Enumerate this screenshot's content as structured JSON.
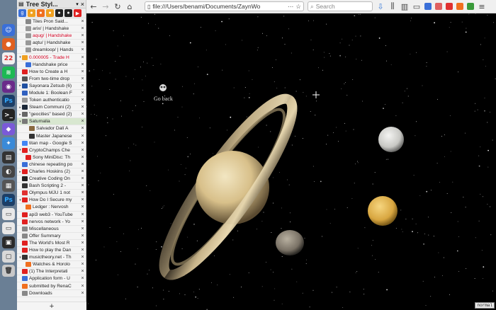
{
  "sidebar": {
    "title": "Tree Styl...",
    "new_tab": "+",
    "tabs": [
      {
        "title": "Tiles Pron Said...",
        "indent": 1,
        "fav": "#888",
        "red": false
      },
      {
        "title": "arix/ | Handshake",
        "indent": 1,
        "fav": "#999",
        "red": false
      },
      {
        "title": "aqug/ | Handshake",
        "indent": 1,
        "fav": "#999",
        "red": true
      },
      {
        "title": "aqtu/ | Handshake",
        "indent": 1,
        "fav": "#999",
        "red": false
      },
      {
        "title": "dreamloop/ | Hands",
        "indent": 1,
        "fav": "#999",
        "red": false
      },
      {
        "title": "0.000005 - Trade H",
        "indent": 0,
        "fav": "#f0a020",
        "red": true,
        "tw": "v"
      },
      {
        "title": "Handshake price",
        "indent": 1,
        "fav": "#3a6fd8",
        "red": false
      },
      {
        "title": "How to Create a H",
        "indent": 0,
        "fav": "#e02020",
        "red": false
      },
      {
        "title": "From two-time drop",
        "indent": 0,
        "fav": "#555",
        "red": false
      },
      {
        "title": "Sayonara Zetsub (6)",
        "indent": 0,
        "fav": "#2050a0",
        "red": false,
        "tw": ">"
      },
      {
        "title": "Module 1: Boolean F",
        "indent": 0,
        "fav": "#3060c0",
        "red": false
      },
      {
        "title": "Token authenticatio",
        "indent": 0,
        "fav": "#999",
        "red": false
      },
      {
        "title": "Steam Communi (2)",
        "indent": 0,
        "fav": "#1b2838",
        "red": false,
        "tw": ">"
      },
      {
        "title": "\"geocities\" based (2)",
        "indent": 0,
        "fav": "#666",
        "red": false,
        "tw": ">"
      },
      {
        "title": "Saturnalia",
        "indent": 0,
        "fav": "#777",
        "red": false,
        "tw": "v",
        "active": true
      },
      {
        "title": "Salvador Dalí A",
        "indent": 2,
        "fav": "#8a6a40",
        "red": false
      },
      {
        "title": "Master Japanese",
        "indent": 2,
        "fav": "#333",
        "red": false
      },
      {
        "title": "titan map - Google S",
        "indent": 0,
        "fav": "#4285f4",
        "red": false
      },
      {
        "title": "CryptoChamps Che",
        "indent": 0,
        "fav": "#e02020",
        "red": false,
        "tw": "v"
      },
      {
        "title": "Sony MiniDisc: Th",
        "indent": 1,
        "fav": "#e02020",
        "red": false
      },
      {
        "title": "chinese repeating po",
        "indent": 0,
        "fav": "#3a6fd8",
        "red": false
      },
      {
        "title": "Charles Hoskins (2)",
        "indent": 0,
        "fav": "#e02020",
        "red": false,
        "tw": ">"
      },
      {
        "title": "Creative Coding On",
        "indent": 0,
        "fav": "#222",
        "red": false
      },
      {
        "title": "Bash Scripting 2 -",
        "indent": 0,
        "fav": "#333",
        "red": false
      },
      {
        "title": "Olympus MJU 1 not",
        "indent": 0,
        "fav": "#e03030",
        "red": false
      },
      {
        "title": "How Do I Secure my",
        "indent": 0,
        "fav": "#e02020",
        "red": false,
        "tw": "v"
      },
      {
        "title": "Ledger : Nervosh",
        "indent": 1,
        "fav": "#f07020",
        "red": false
      },
      {
        "title": "api3 web3 - YouTube",
        "indent": 0,
        "fav": "#e02020",
        "red": false
      },
      {
        "title": "nervos network - Yo",
        "indent": 0,
        "fav": "#e02020",
        "red": false
      },
      {
        "title": "Miscellaneous",
        "indent": 0,
        "fav": "#888",
        "red": false
      },
      {
        "title": "Offer Summary",
        "indent": 0,
        "fav": "#888",
        "red": false
      },
      {
        "title": "The World's Most R",
        "indent": 0,
        "fav": "#e02020",
        "red": false
      },
      {
        "title": "How to play the Dan",
        "indent": 0,
        "fav": "#e02020",
        "red": false
      },
      {
        "title": "musictheory.net - Th",
        "indent": 0,
        "fav": "#333",
        "red": false,
        "tw": "v"
      },
      {
        "title": "Watches & Horolo",
        "indent": 1,
        "fav": "#f07020",
        "red": false
      },
      {
        "title": "(1) The Interpretati",
        "indent": 0,
        "fav": "#e02020",
        "red": false
      },
      {
        "title": "Application form - U",
        "indent": 0,
        "fav": "#3a6fd8",
        "red": false
      },
      {
        "title": "submitted by RenaC",
        "indent": 0,
        "fav": "#f07020",
        "red": false
      },
      {
        "title": "Downloads",
        "indent": 0,
        "fav": "#888",
        "red": false
      }
    ]
  },
  "toolbar": {
    "url": "file:///Users/benami/Documents/ZaynWo",
    "search_placeholder": "Search"
  },
  "content": {
    "go_back": "Go back",
    "mode": "normal"
  }
}
